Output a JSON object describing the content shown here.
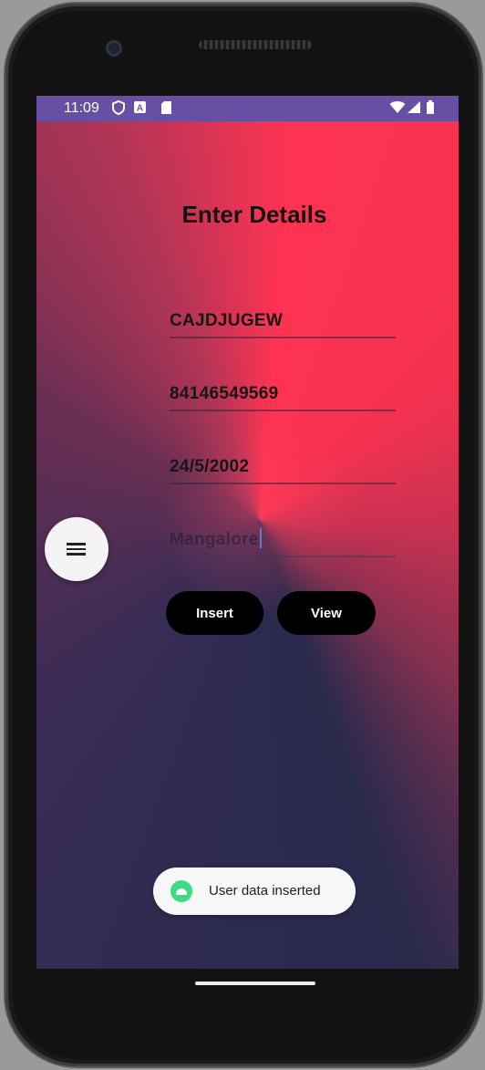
{
  "status_bar": {
    "time": "11:09",
    "icons": [
      "shield-icon",
      "a-notification-icon",
      "sd-card-icon",
      "wifi-icon",
      "signal-icon",
      "battery-icon"
    ]
  },
  "form": {
    "title": "Enter Details",
    "fields": [
      {
        "name": "name",
        "value": "CAJDJUGEW"
      },
      {
        "name": "phone",
        "value": "84146549569"
      },
      {
        "name": "dob",
        "value": "24/5/2002"
      },
      {
        "name": "city",
        "value": "Mangalore"
      }
    ],
    "insert_label": "Insert",
    "view_label": "View"
  },
  "fab": {
    "icon": "menu-icon"
  },
  "toast": {
    "icon": "android-icon",
    "message": "User data inserted"
  },
  "colors": {
    "status_bar": "#6750a4",
    "gradient_red": "#ff3352",
    "gradient_navy": "#2b2a4f",
    "button": "#000000",
    "toast_icon": "#3ddc84"
  }
}
